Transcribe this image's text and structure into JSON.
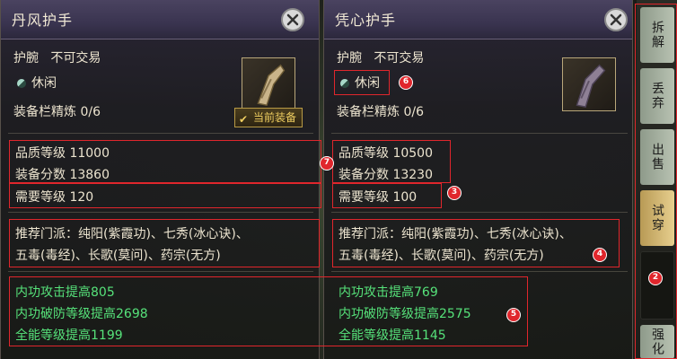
{
  "left_item": {
    "title": "丹风护手",
    "slot": "护腕",
    "trade": "不可交易",
    "style": "休闲",
    "refine": "装备栏精炼 0/6",
    "equipped_tag": "当前装备",
    "quality": "品质等级 11000",
    "score": "装备分数 13860",
    "req_level": "需要等级 120",
    "recommend_line1": "推荐门派：纯阳(紫霞功)、七秀(冰心诀)、",
    "recommend_line2": "五毒(毒经)、长歌(莫问)、药宗(无方)",
    "attr1": "内功攻击提高805",
    "attr2": "内功破防等级提高2698",
    "attr3": "全能等级提高1199"
  },
  "right_item": {
    "title": "凭心护手",
    "slot": "护腕",
    "trade": "不可交易",
    "style": "休闲",
    "refine": "装备栏精炼 0/6",
    "quality": "品质等级 10500",
    "score": "装备分数 13230",
    "req_level": "需要等级 100",
    "recommend_line1": "推荐门派：纯阳(紫霞功)、七秀(冰心诀)、",
    "recommend_line2": "五毒(毒经)、长歌(莫问)、药宗(无方)",
    "attr1": "内功攻击提高769",
    "attr2": "内功破防等级提高2575",
    "attr3": "全能等级提高1145"
  },
  "sidebar": {
    "tabs": [
      "拆解",
      "丢弃",
      "出售",
      "试穿",
      "",
      "强化"
    ]
  },
  "annotations": [
    "2",
    "3",
    "4",
    "5",
    "6",
    "7"
  ],
  "colors": {
    "highlight_red": "#e0262c",
    "stat_green": "#56e27a",
    "equipped_gold": "#f0cf61"
  }
}
